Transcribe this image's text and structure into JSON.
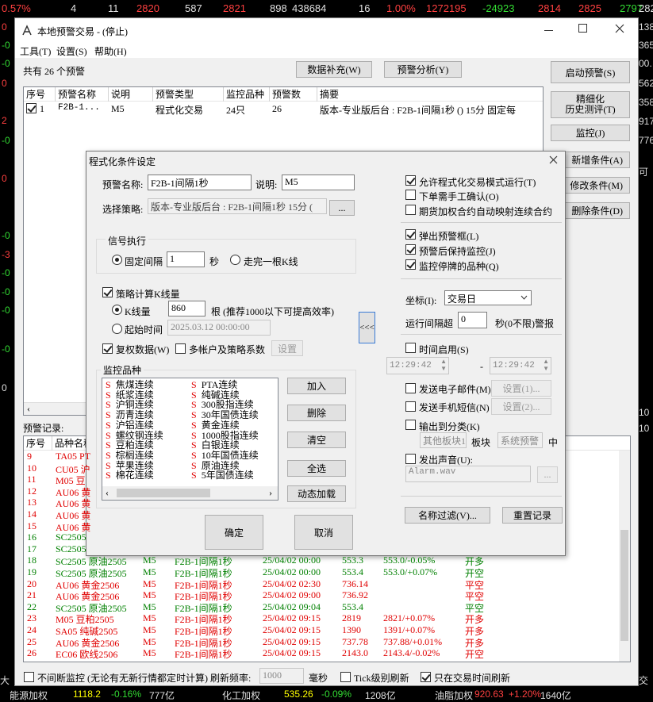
{
  "ticker": [
    "0.57%",
    "4",
    "11",
    "2820",
    "587",
    "2821",
    "898",
    "438684",
    "16",
    "1.00%",
    "1272195",
    "-24923",
    "2814",
    "2825",
    "2797",
    "282"
  ],
  "left_edge": [
    "0",
    "-0",
    "-0",
    "0",
    "2",
    "-0",
    "0",
    "-0",
    "-3",
    "-0",
    "-0",
    "-0",
    "-0",
    "0"
  ],
  "right_edge": [
    "138",
    "365",
    "00.",
    "562",
    "358",
    "917",
    "776",
    "可",
    "10",
    "10",
    "交"
  ],
  "main": {
    "title": "本地预警交易 - (停止)",
    "menu": [
      "工具(T)",
      "设置(S)",
      "帮助(H)"
    ],
    "count_label": "共有 26 个预警",
    "btn_data_fill": "数据补充(W)",
    "btn_analysis": "预警分析(Y)",
    "right_buttons": [
      "启动预警(S)",
      "精细化\n历史测评(T)",
      "监控(J)",
      "新增条件(A)",
      "修改条件(M)",
      "删除条件(D)"
    ],
    "table_headers": [
      "序号",
      "预警名称",
      "说明",
      "预警类型",
      "监控品种",
      "预警数",
      "摘要"
    ],
    "table_row": [
      "1",
      "F2B-1...",
      "M5",
      "程式化交易",
      "24只",
      "26",
      "版本-专业版后台 : F2B-1间隔1秒 () 15分 固定每"
    ],
    "records_label": "预警记录:",
    "records_headers": [
      "序号",
      "品种名称"
    ],
    "bottom": {
      "continuous_label": "不间断监控 (无论有无新行情都定时计算) 刷新频率:",
      "freq_value": "1000",
      "freq_unit": "毫秒",
      "tick_label": "Tick级别刷新",
      "trade_time_label": "只在交易时间刷新"
    }
  },
  "records": [
    {
      "n": "9",
      "name": "TA05 PT",
      "c": "red"
    },
    {
      "n": "10",
      "name": "CU05 沪",
      "c": "red"
    },
    {
      "n": "11",
      "name": "M05 豆",
      "c": "red"
    },
    {
      "n": "12",
      "name": "AU06 黄",
      "c": "red"
    },
    {
      "n": "13",
      "name": "AU06 黄",
      "c": "red"
    },
    {
      "n": "14",
      "name": "AU06 黄",
      "c": "red"
    },
    {
      "n": "15",
      "name": "AU06 黄",
      "c": "red"
    },
    {
      "n": "16",
      "name": "SC2505",
      "c": "grn"
    },
    {
      "n": "17",
      "name": "SC2505",
      "c": "grn"
    },
    {
      "n": "18",
      "name": "SC2505 原油2505",
      "desc": "M5",
      "cond": "F2B-1间隔1秒",
      "time": "25/04/02 00:00",
      "price": "553.3",
      "chg": "553.0/-0.05%",
      "act": "开多",
      "c": "grn"
    },
    {
      "n": "19",
      "name": "SC2505 原油2505",
      "desc": "M5",
      "cond": "F2B-1间隔1秒",
      "time": "25/04/02 00:00",
      "price": "553.4",
      "chg": "553.0/+0.07%",
      "act": "开空",
      "c": "grn"
    },
    {
      "n": "20",
      "name": "AU06 黄金2506",
      "desc": "M5",
      "cond": "F2B-1间隔1秒",
      "time": "25/04/02 02:30",
      "price": "736.14",
      "chg": "",
      "act": "平空",
      "c": "red"
    },
    {
      "n": "21",
      "name": "AU06 黄金2506",
      "desc": "M5",
      "cond": "F2B-1间隔1秒",
      "time": "25/04/02 09:00",
      "price": "736.92",
      "chg": "",
      "act": "平空",
      "c": "red"
    },
    {
      "n": "22",
      "name": "SC2505 原油2505",
      "desc": "M5",
      "cond": "F2B-1间隔1秒",
      "time": "25/04/02 09:04",
      "price": "553.4",
      "chg": "",
      "act": "平空",
      "c": "grn"
    },
    {
      "n": "23",
      "name": "M05 豆粕2505",
      "desc": "M5",
      "cond": "F2B-1间隔1秒",
      "time": "25/04/02 09:15",
      "price": "2819",
      "chg": "2821/+0.07%",
      "act": "开多",
      "c": "red"
    },
    {
      "n": "24",
      "name": "SA05 纯碱2505",
      "desc": "M5",
      "cond": "F2B-1间隔1秒",
      "time": "25/04/02 09:15",
      "price": "1390",
      "chg": "1391/+0.07%",
      "act": "开多",
      "c": "red"
    },
    {
      "n": "25",
      "name": "AU06 黄金2506",
      "desc": "M5",
      "cond": "F2B-1间隔1秒",
      "time": "25/04/02 09:15",
      "price": "737.78",
      "chg": "737.88/+0.01%",
      "act": "开多",
      "c": "red"
    },
    {
      "n": "26",
      "name": "EC06 欧线2506",
      "desc": "M5",
      "cond": "F2B-1间隔1秒",
      "time": "25/04/02 09:15",
      "price": "2143.0",
      "chg": "2143.4/-0.02%",
      "act": "开空",
      "c": "red"
    }
  ],
  "dialog": {
    "title": "程式化条件设定",
    "name_label": "预警名称:",
    "name_value": "F2B-1间隔1秒",
    "desc_label": "说明:",
    "desc_value": "M5",
    "strategy_label": "选择策略:",
    "strategy_value": "版本-专业版后台 : F2B-1间隔1秒 15分 (",
    "browse_btn": "...",
    "signal_group": "信号执行",
    "fixed_interval": "固定间隔",
    "interval_value": "1",
    "seconds": "秒",
    "walk_kline": "走完一根K线",
    "kline_calc": "策略计算K线量",
    "kline_qty": "K线量",
    "kline_value": "860",
    "kline_hint": "根 (推荐1000以下可提高效率)",
    "start_time": "起始时间",
    "start_time_value": "2025.03.12 00:00:00",
    "rights_data": "复权数据(W)",
    "multi_account": "多帐户及策略系数",
    "settings_btn": "设置",
    "monitor_group": "监控品种",
    "varieties_left": [
      "焦煤连续",
      "纸浆连续",
      "沪铜连续",
      "沥青连续",
      "沪铝连续",
      "螺纹钢连续",
      "豆粕连续",
      "棕榈连续",
      "苹果连续",
      "棉花连续"
    ],
    "varieties_right": [
      "PTA连续",
      "纯碱连续",
      "300股指连续",
      "30年国债连续",
      "黄金连续",
      "1000股指连续",
      "白银连续",
      "10年国债连续",
      "原油连续",
      "5年国债连续"
    ],
    "variety_marker": "S",
    "btn_add": "加入",
    "btn_delete": "删除",
    "btn_clear": "清空",
    "btn_select_all": "全选",
    "btn_dynamic": "动态加载",
    "btn_ok": "确定",
    "btn_cancel": "取消",
    "collapse_btn": "<<<",
    "allow_prog": "允许程式化交易模式运行(T)",
    "manual_confirm": "下单需手工确认(O)",
    "futures_map": "期货加权合约自动映射连续合约",
    "popup": "弹出预警框(L)",
    "keep_monitor": "预警后保持监控(J)",
    "monitor_suspended": "监控停牌的品种(Q)",
    "coord_label": "坐标(I):",
    "coord_value": "交易日",
    "run_interval_label": "运行间隔超",
    "run_interval_value": "0",
    "run_interval_hint": "秒(0不限)警报",
    "time_enable": "时间启用(S)",
    "time_from": "12:29:42",
    "time_dash": "-",
    "time_to": "12:29:42",
    "email": "发送电子邮件(M)",
    "email_btn": "设置(1)...",
    "sms": "发送手机短信(N)",
    "sms_btn": "设置(2)...",
    "output_cat": "输出到分类(K)",
    "other_board": "其他板块1",
    "board_label": "板块",
    "sys_alert": "系统预警",
    "mid_label": "中",
    "sound": "发出声音(U):",
    "sound_file": "Alarm.wav",
    "sound_btn": "...",
    "name_filter": "名称过滤(V)...",
    "reset_record": "重置记录"
  },
  "status": [
    {
      "t": "能源加权",
      "c": "w"
    },
    {
      "t": "1118.2",
      "c": "y"
    },
    {
      "t": "-0.16%",
      "c": "g"
    },
    {
      "t": "777亿",
      "c": "w"
    },
    {
      "t": "化工加权",
      "c": "w"
    },
    {
      "t": "535.26",
      "c": "y"
    },
    {
      "t": "-0.09%",
      "c": "g"
    },
    {
      "t": "1208亿",
      "c": "w"
    },
    {
      "t": "油脂加权",
      "c": "w"
    },
    {
      "t": "920.63",
      "c": "r"
    },
    {
      "t": "+1.20%",
      "c": "r"
    },
    {
      "t": "1640亿",
      "c": "w"
    }
  ]
}
